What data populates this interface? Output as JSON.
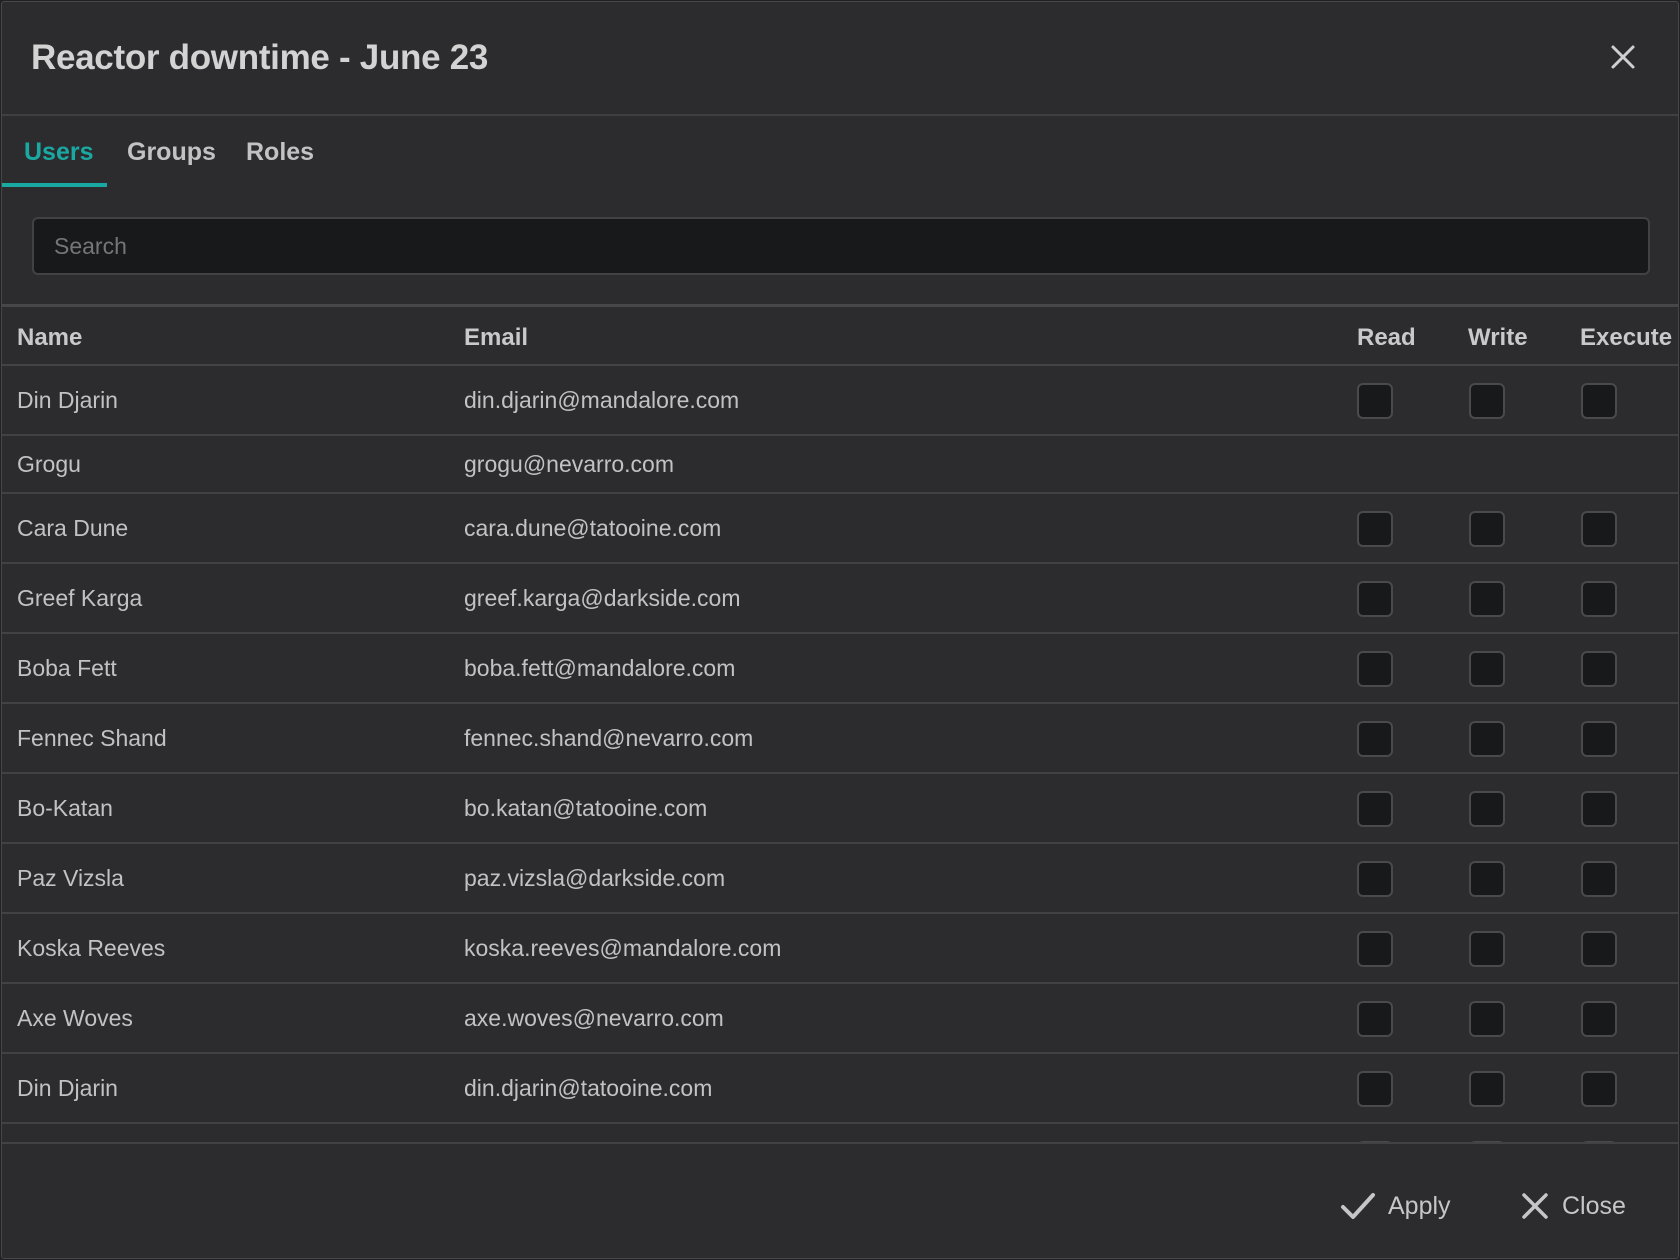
{
  "dialog": {
    "title": "Reactor downtime - June 23"
  },
  "tabs": [
    {
      "label": "Users",
      "active": true
    },
    {
      "label": "Groups",
      "active": false
    },
    {
      "label": "Roles",
      "active": false
    }
  ],
  "search": {
    "placeholder": "Search",
    "value": ""
  },
  "table": {
    "headers": {
      "name": "Name",
      "email": "Email",
      "read": "Read",
      "write": "Write",
      "execute": "Execute"
    },
    "rows": [
      {
        "name": "Din Djarin",
        "email": "din.djarin@mandalore.com",
        "has_permissions": true
      },
      {
        "name": "Grogu",
        "email": "grogu@nevarro.com",
        "has_permissions": false
      },
      {
        "name": "Cara Dune",
        "email": "cara.dune@tatooine.com",
        "has_permissions": true
      },
      {
        "name": "Greef Karga",
        "email": "greef.karga@darkside.com",
        "has_permissions": true
      },
      {
        "name": "Boba Fett",
        "email": "boba.fett@mandalore.com",
        "has_permissions": true
      },
      {
        "name": "Fennec Shand",
        "email": "fennec.shand@nevarro.com",
        "has_permissions": true
      },
      {
        "name": "Bo-Katan",
        "email": "bo.katan@tatooine.com",
        "has_permissions": true
      },
      {
        "name": "Paz Vizsla",
        "email": "paz.vizsla@darkside.com",
        "has_permissions": true
      },
      {
        "name": "Koska Reeves",
        "email": "koska.reeves@mandalore.com",
        "has_permissions": true
      },
      {
        "name": "Axe Woves",
        "email": "axe.woves@nevarro.com",
        "has_permissions": true
      },
      {
        "name": "Din Djarin",
        "email": "din.djarin@tatooine.com",
        "has_permissions": true
      }
    ]
  },
  "footer": {
    "apply_label": "Apply",
    "close_label": "Close"
  },
  "colors": {
    "accent": "#1aa8a3",
    "background": "#2c2c2f"
  },
  "icons": {
    "close": "close-icon",
    "apply": "check-icon",
    "footer_close": "close-icon"
  }
}
